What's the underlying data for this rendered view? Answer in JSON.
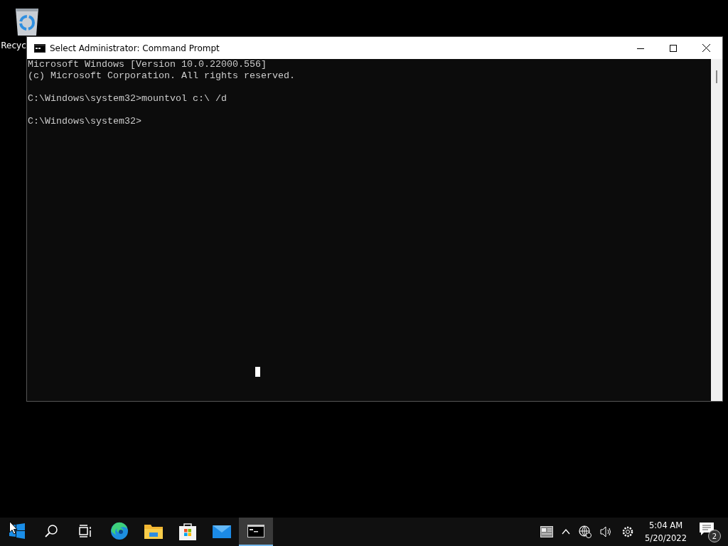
{
  "desktop": {
    "icons": [
      {
        "label": "Recyc"
      }
    ]
  },
  "window": {
    "title": "Select Administrator: Command Prompt",
    "console_blocks": [
      [
        "Microsoft Windows [Version 10.0.22000.556]",
        "(c) Microsoft Corporation. All rights reserved."
      ],
      [
        "C:\\Windows\\system32>mountvol c:\\ /d"
      ],
      [
        "C:\\Windows\\system32>"
      ]
    ]
  },
  "taskbar": {
    "items": [
      {
        "kind": "start",
        "selected": false
      },
      {
        "kind": "search",
        "selected": false
      },
      {
        "kind": "task-view",
        "selected": false
      },
      {
        "kind": "browser",
        "selected": false
      },
      {
        "kind": "folder",
        "selected": false
      },
      {
        "kind": "store",
        "selected": false
      },
      {
        "kind": "mail",
        "selected": false
      },
      {
        "kind": "console",
        "selected": true
      }
    ],
    "clock": {
      "time": "5:04 AM",
      "date": "5/20/2022"
    },
    "notifications": {
      "count": "2"
    }
  }
}
